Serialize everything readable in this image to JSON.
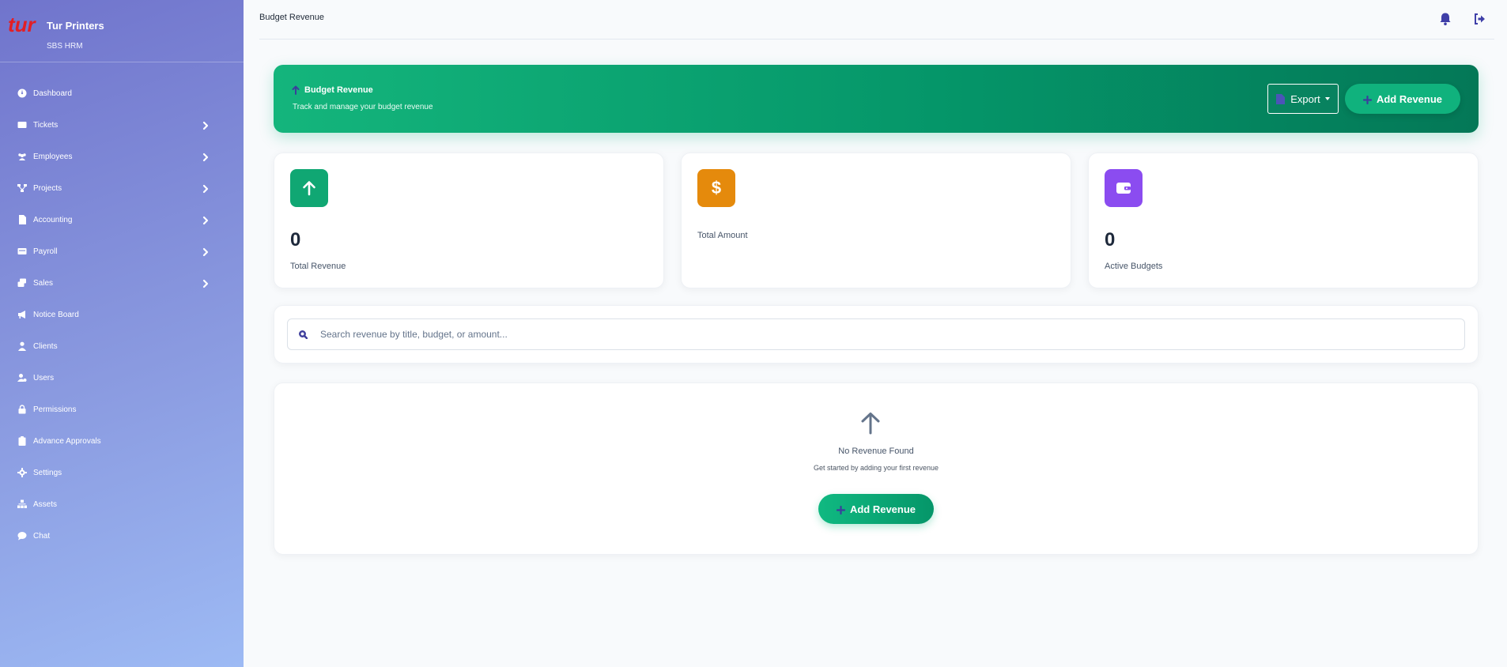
{
  "brand": {
    "logo_text": "tur",
    "name": "Tur Printers",
    "subtitle": "SBS HRM"
  },
  "sidebar": {
    "items": [
      {
        "label": "Dashboard",
        "icon": "dashboard-icon",
        "has_submenu": false
      },
      {
        "label": "Tickets",
        "icon": "ticket-icon",
        "has_submenu": true
      },
      {
        "label": "Employees",
        "icon": "users-group-icon",
        "has_submenu": true
      },
      {
        "label": "Projects",
        "icon": "project-diagram-icon",
        "has_submenu": true
      },
      {
        "label": "Accounting",
        "icon": "file-icon",
        "has_submenu": true
      },
      {
        "label": "Payroll",
        "icon": "money-card-icon",
        "has_submenu": true
      },
      {
        "label": "Sales",
        "icon": "layers-icon",
        "has_submenu": true
      },
      {
        "label": "Notice Board",
        "icon": "megaphone-icon",
        "has_submenu": false
      },
      {
        "label": "Clients",
        "icon": "user-icon",
        "has_submenu": false
      },
      {
        "label": "Users",
        "icon": "user-cog-icon",
        "has_submenu": false
      },
      {
        "label": "Permissions",
        "icon": "lock-icon",
        "has_submenu": false
      },
      {
        "label": "Advance Approvals",
        "icon": "clipboard-icon",
        "has_submenu": false
      },
      {
        "label": "Settings",
        "icon": "gear-icon",
        "has_submenu": false
      },
      {
        "label": "Assets",
        "icon": "sitemap-icon",
        "has_submenu": false
      },
      {
        "label": "Chat",
        "icon": "chat-icon",
        "has_submenu": false
      }
    ]
  },
  "topbar": {
    "title": "Budget Revenue",
    "icons": [
      "bell-icon",
      "logout-icon"
    ]
  },
  "hero": {
    "title": "Budget Revenue",
    "subtitle": "Track and manage your budget revenue",
    "export_label": "Export",
    "add_label": "Add Revenue"
  },
  "stats": [
    {
      "value": "0",
      "label": "Total Revenue",
      "icon": "arrow-up-icon",
      "color": "#10a773"
    },
    {
      "value": "",
      "label": "Total Amount",
      "icon": "dollar-icon",
      "color": "#e58a0c"
    },
    {
      "value": "0",
      "label": "Active Budgets",
      "icon": "wallet-icon",
      "color": "#8b4cf0"
    }
  ],
  "search": {
    "placeholder": "Search revenue by title, budget, or amount..."
  },
  "empty": {
    "title": "No Revenue Found",
    "subtitle": "Get started by adding your first revenue",
    "add_label": "Add Revenue"
  },
  "colors": {
    "accent": "#10b981",
    "sidebar_start": "#7074cc",
    "sidebar_end": "#9dbaf4",
    "icon_dark": "#3f3fa8"
  }
}
